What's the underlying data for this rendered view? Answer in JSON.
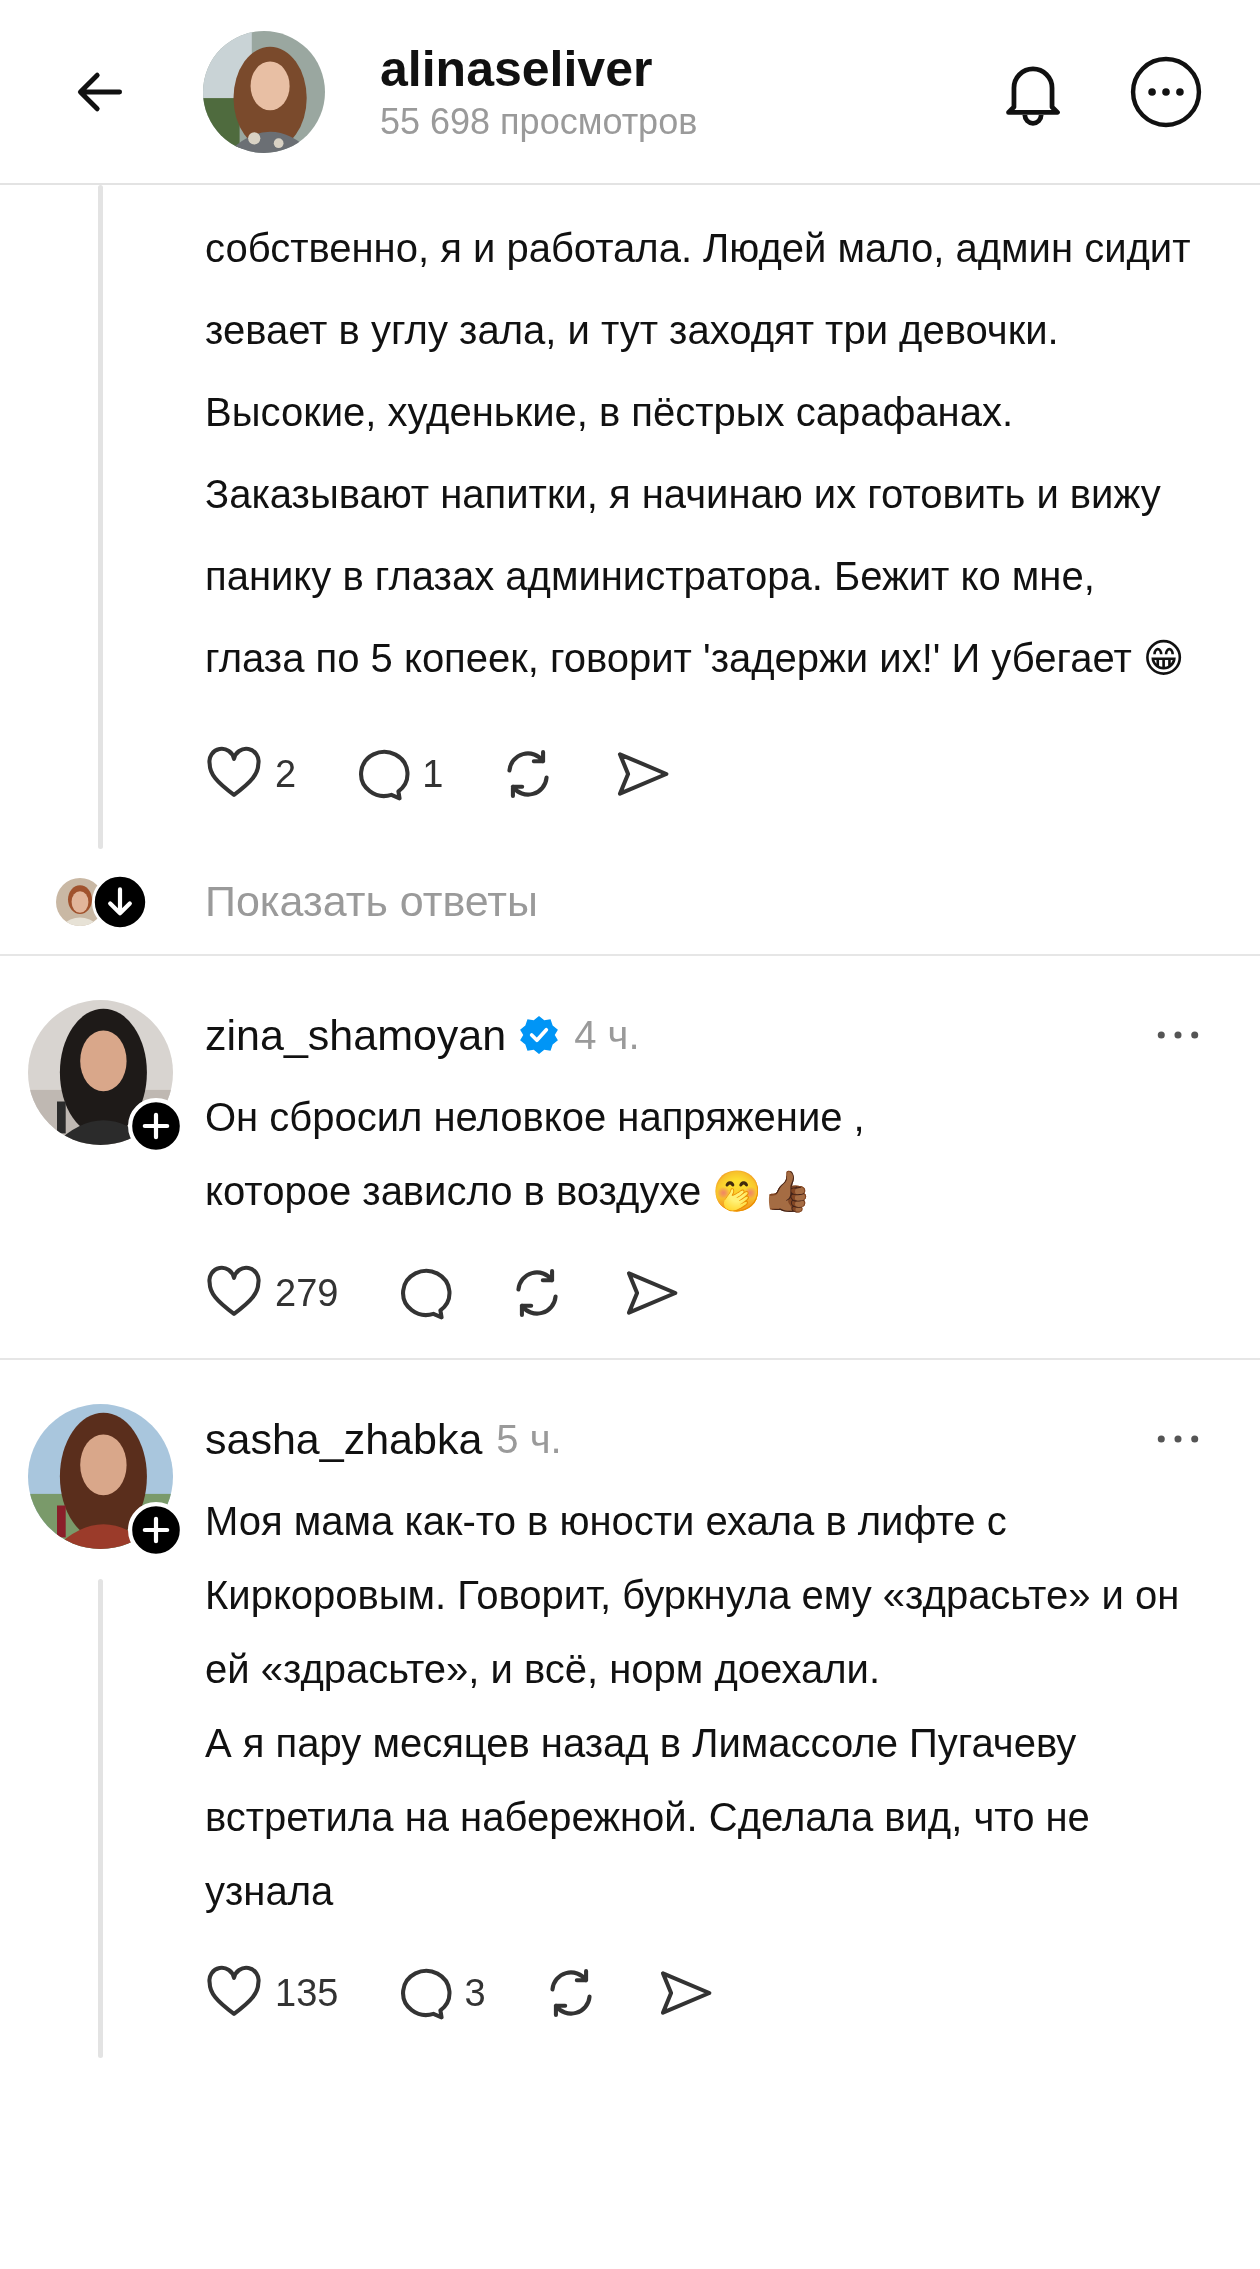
{
  "header": {
    "username": "alinaseliver",
    "views": "55 698 просмотров"
  },
  "main_post": {
    "text": "собственно, я и работала. Людей мало, админ сидит зевает в углу зала, и тут заходят три девочки. Высокие, худенькие, в пёстрых сарафанах. Заказывают напитки, я начинаю их готовить и вижу панику в глазах администратора. Бежит ко мне, глаза по 5 копеек, говорит 'задержи их!' И убегает 😁",
    "likes": "2",
    "replies": "1",
    "show_replies": "Показать ответы"
  },
  "comments": [
    {
      "username": "zina_shamoyan",
      "verified": true,
      "time": "4 ч.",
      "text": "Он сбросил неловкое  напряжение ,\nкоторое зависло в воздухе 🤭👍🏾",
      "likes": "279",
      "thread": false
    },
    {
      "username": "sasha_zhabka",
      "verified": false,
      "time": "5 ч.",
      "text": "Моя мама как-то в юности ехала в лифте с Киркоровым. Говорит, буркнула ему «здрасьте» и он ей «здрасьте», и всё, норм доехали.\nА я пару месяцев назад в Лимассоле Пугачеву встретила на набережной. Сделала вид, что не узнала",
      "likes": "135",
      "replies": "3",
      "thread": true
    }
  ]
}
